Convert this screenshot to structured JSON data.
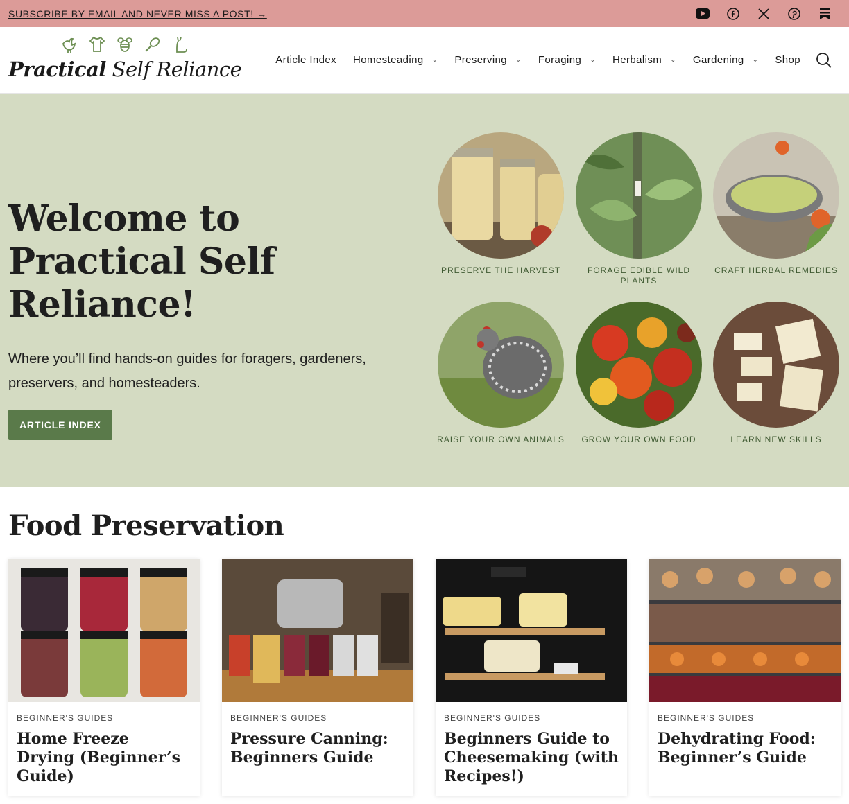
{
  "topbar": {
    "subscribe_text": "SUBSCRIBE BY EMAIL AND NEVER MISS A POST! →",
    "social": [
      {
        "icon": "youtube-icon"
      },
      {
        "icon": "facebook-icon"
      },
      {
        "icon": "x-icon"
      },
      {
        "icon": "pinterest-icon"
      },
      {
        "icon": "bookmark-icon"
      }
    ],
    "background_color": "#dc9b98"
  },
  "header": {
    "logo_bold": "Practical",
    "logo_light": " Self Reliance",
    "logo_icons": [
      "rooster-icon",
      "shirt-icon",
      "bee-icon",
      "whisk-icon",
      "cat-icon"
    ],
    "nav": [
      {
        "label": "Article Index",
        "has_dropdown": false
      },
      {
        "label": "Homesteading",
        "has_dropdown": true
      },
      {
        "label": "Preserving",
        "has_dropdown": true
      },
      {
        "label": "Foraging",
        "has_dropdown": true
      },
      {
        "label": "Herbalism",
        "has_dropdown": true
      },
      {
        "label": "Gardening",
        "has_dropdown": true
      },
      {
        "label": "Shop",
        "has_dropdown": false
      }
    ]
  },
  "hero": {
    "title": "Welcome to Practical Self Reliance!",
    "subtitle": "Where you’ll find hands-on guides for foragers, gardeners, preservers, and homesteaders.",
    "button_label": "ARTICLE INDEX",
    "background_color": "#d4dbc2",
    "accent_color": "#5a7a4a",
    "categories": [
      {
        "label": "PRESERVE THE HARVEST"
      },
      {
        "label": "FORAGE EDIBLE WILD PLANTS"
      },
      {
        "label": "CRAFT HERBAL REMEDIES"
      },
      {
        "label": "RAISE YOUR OWN ANIMALS"
      },
      {
        "label": "GROW YOUR OWN FOOD"
      },
      {
        "label": "LEARN NEW SKILLS"
      }
    ]
  },
  "food_preservation": {
    "title": "Food Preservation",
    "cards": [
      {
        "kicker": "BEGINNER'S GUIDES",
        "title": "Home Freeze Drying (Beginner’s Guide)"
      },
      {
        "kicker": "BEGINNER'S GUIDES",
        "title": "Pressure Canning: Beginners Guide"
      },
      {
        "kicker": "BEGINNER'S GUIDES",
        "title": "Beginners Guide to Cheesemaking (with Recipes!)"
      },
      {
        "kicker": "BEGINNER'S GUIDES",
        "title": "Dehydrating Food: Beginner’s Guide"
      }
    ]
  }
}
